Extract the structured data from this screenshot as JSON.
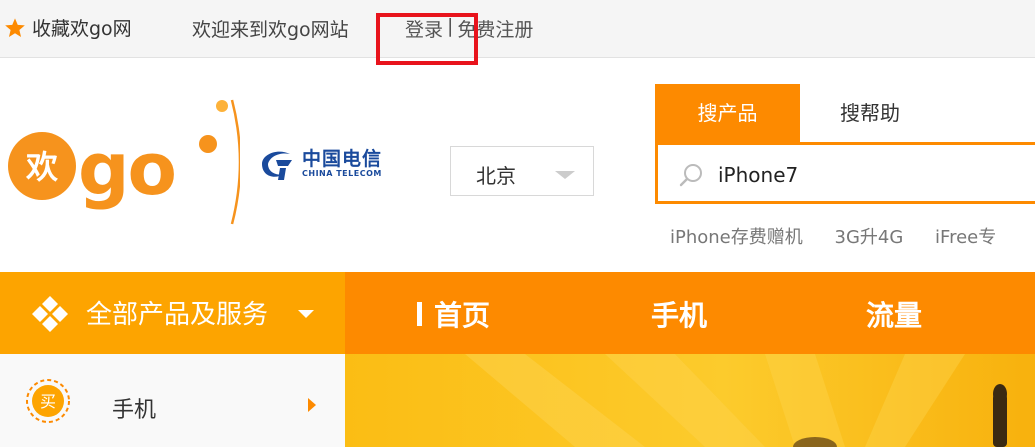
{
  "topbar": {
    "favorite_label": "收藏欢go网",
    "welcome": "欢迎来到欢go网站",
    "login": "登录",
    "separator": "|",
    "register": "免费注册"
  },
  "brand": {
    "logo_text": "欢go",
    "partner_cn": "中国电信",
    "partner_en": "CHINA TELECOM"
  },
  "location": {
    "city": "北京"
  },
  "search": {
    "tabs": [
      "搜产品",
      "搜帮助"
    ],
    "value": "iPhone7",
    "hot_keywords": [
      "iPhone存费赠机",
      "3G升4G",
      "iFree专"
    ]
  },
  "nav": {
    "all_label": "全部产品及服务",
    "items": [
      "首页",
      "手机",
      "流量"
    ]
  },
  "sidebar": {
    "items": [
      {
        "badge": "买",
        "label": "手机"
      }
    ]
  },
  "colors": {
    "accent": "#fd8a00",
    "accent_light": "#fda400",
    "highlight": "#e8131c",
    "telecom_blue": "#1a4a9c"
  }
}
